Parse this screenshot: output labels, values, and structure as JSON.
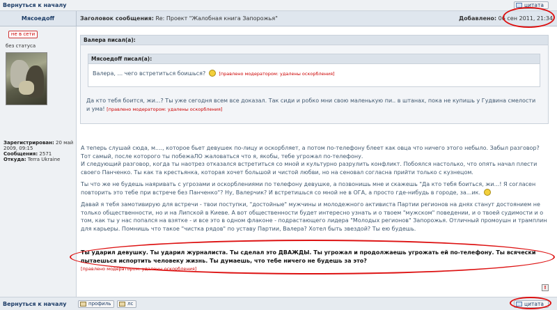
{
  "nav": {
    "back_to_top": "Вернуться к началу"
  },
  "buttons": {
    "quote": "цитата",
    "profile": "профиль",
    "pm": "лс"
  },
  "post": {
    "author": "Мясоедоff",
    "subject_label": "Заголовок сообщения:",
    "subject": "Re: Проект \"Жалобная книга Запорожья\"",
    "added_label": "Добавлено:",
    "added_date": "06 сен 2011, 21:34"
  },
  "user": {
    "online": "не в сети",
    "status": "без статуса",
    "registered_label": "Зарегистрирован:",
    "registered": "20 май 2009, 09:15",
    "posts_label": "Сообщения:",
    "posts": "2571",
    "from_label": "Откуда:",
    "from": "Terra Ukraine"
  },
  "quote_outer": {
    "header": "Валера писал(а):",
    "text": "Да кто тебя боится, жи...? Ты уже сегодня всем все доказал. Так сиди и робко мни свою маленькую пи.. в штанах, пока не купишь у Гудвина смелости и ума!",
    "mod_note": "[правлено модератором: удалены оскорбления]"
  },
  "quote_inner": {
    "header": "Мясоедoff писал(а):",
    "text": "Валера, ... чего встретиться боишься?",
    "mod_note": "[правлено модератором: удалены оскорбления]"
  },
  "body": {
    "p1": "А теперь слушай сюда, м...., которое бьет девушек по-лицу и оскорбляет, а потом по-телефону блеет как овца что ничего этого небыло. Забыл разговор? Тот самый, после которого ты побежаЛО жаловаться что я, якобы, тебе угрожал по-телефону.",
    "p2": "И следующий разговор, когда ты наотрез отказался встретиться со мной и культурно разрулить конфликт. Побоялся настолько, что опять начал плести своего Панченко. Ты как та крестьянка, которая хочет большой и чистой любви, но на сеновал согласна прийти только с кузнецом.",
    "p3": "Ты что же не будешь наяривать с угрозами и оскорблениями по телефону девушке, а позвонишь мне и скажешь \"Да кто тебя боиться, жи...! Я согласен повторить это тебе при встрече без Панченко\"? Ну, Валерчик? И встретишься со мной не в ОГА, а просто где-нибудь в городе, за...ик.",
    "p4": "Давай я тебя замотивирую для встречи - твои поступки, \"достойные\" мужчины и молодежного активиста Партии регионов на днях станут достоянием не только общественности, но и на Липской в Киеве. А вот общественности будет интересно узнать и о твоем \"мужском\" поведении, и о твоей судимости и о том, как ты у нас попался на взятке - и все это в одном флаконе - подрастающего лидера \"Молодых регионов\" Запорожья. Отличный промоушн и трамплин для карьеры. Помнишь что такое \"чистка рядов\" по уставу Партии, Валера? Хотел быть звездой? Ты ею будешь.",
    "bold": "Ты ударил девушку. Ты ударил журналиста. Ты сделал это ДВАЖДЫ. Ты угрожал и продолжаешь угрожать ей по-телефону. Ты всячески пытаешься испортить человеку жизнь. Ты думаешь, что тебе ничего не будешь за это?",
    "mod_note": "[правлено модератором: удалены оскорбления]"
  },
  "colors": {
    "annotation": "#d11111",
    "header_bg": "#dfe6ee",
    "link": "#1b3b66"
  }
}
